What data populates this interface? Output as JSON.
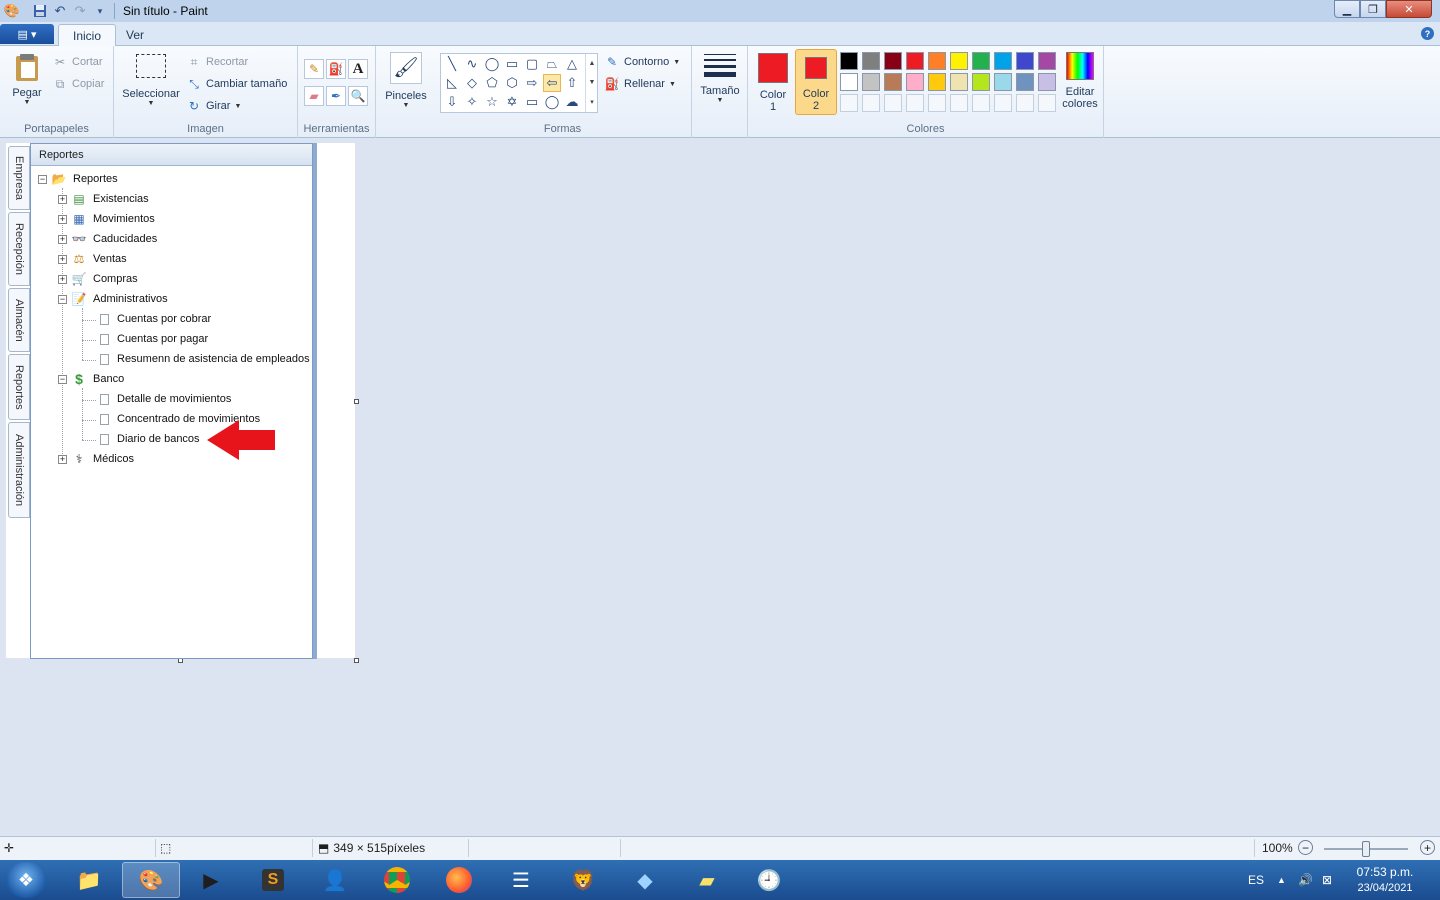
{
  "window": {
    "title": "Sin título - Paint"
  },
  "ribbon": {
    "tabs": [
      {
        "label": "Inicio"
      },
      {
        "label": "Ver"
      }
    ],
    "portapapeles": {
      "label": "Portapapeles",
      "pegar": "Pegar",
      "cortar": "Cortar",
      "copiar": "Copiar"
    },
    "imagen": {
      "label": "Imagen",
      "seleccionar": "Seleccionar",
      "recortar": "Recortar",
      "cambiar_tamano": "Cambiar tamaño",
      "girar": "Girar"
    },
    "herramientas": {
      "label": "Herramientas"
    },
    "pinceles": {
      "label": "Pinceles"
    },
    "formas": {
      "label": "Formas",
      "contorno": "Contorno",
      "rellenar": "Rellenar"
    },
    "tamano": {
      "label": "Tamaño"
    },
    "colores": {
      "label": "Colores",
      "color1_label": "Color",
      "color1_num": "1",
      "color2_label": "Color",
      "color2_num": "2",
      "editar_label": "Editar",
      "editar_label2": "colores",
      "color1_value": "#ed1c24",
      "color2_value": "#ed1c24",
      "palette_row1": [
        "#000000",
        "#7f7f7f",
        "#880015",
        "#ed1c24",
        "#ff7f27",
        "#fff200",
        "#22b14c",
        "#00a2e8",
        "#3f48cc",
        "#a349a4"
      ],
      "palette_row2": [
        "#ffffff",
        "#c3c3c3",
        "#b97a57",
        "#ffaec9",
        "#ffc90e",
        "#efe4b0",
        "#b5e61d",
        "#99d9ea",
        "#7092be",
        "#c8bfe7"
      ]
    }
  },
  "side_tabs": [
    {
      "label": "Empresa"
    },
    {
      "label": "Recepción"
    },
    {
      "label": "Almacén"
    },
    {
      "label": "Reportes"
    },
    {
      "label": "Administración"
    }
  ],
  "panel": {
    "header": "Reportes",
    "tree": {
      "root": "Reportes",
      "items": [
        {
          "label": "Existencias"
        },
        {
          "label": "Movimientos"
        },
        {
          "label": "Caducidades"
        },
        {
          "label": "Ventas"
        },
        {
          "label": "Compras"
        },
        {
          "label": "Administrativos",
          "children": [
            "Cuentas por cobrar",
            "Cuentas por pagar",
            "Resumenn de asistencia de empleados"
          ]
        },
        {
          "label": "Banco",
          "children": [
            "Detalle de movimientos",
            "Concentrado de movimientos",
            "Diario de bancos"
          ]
        },
        {
          "label": "Médicos"
        }
      ]
    }
  },
  "statusbar": {
    "dimensions": "349 × 515píxeles",
    "zoom": "100%"
  },
  "taskbar": {
    "lang": "ES",
    "time": "07:53 p.m.",
    "date": "23/04/2021"
  }
}
